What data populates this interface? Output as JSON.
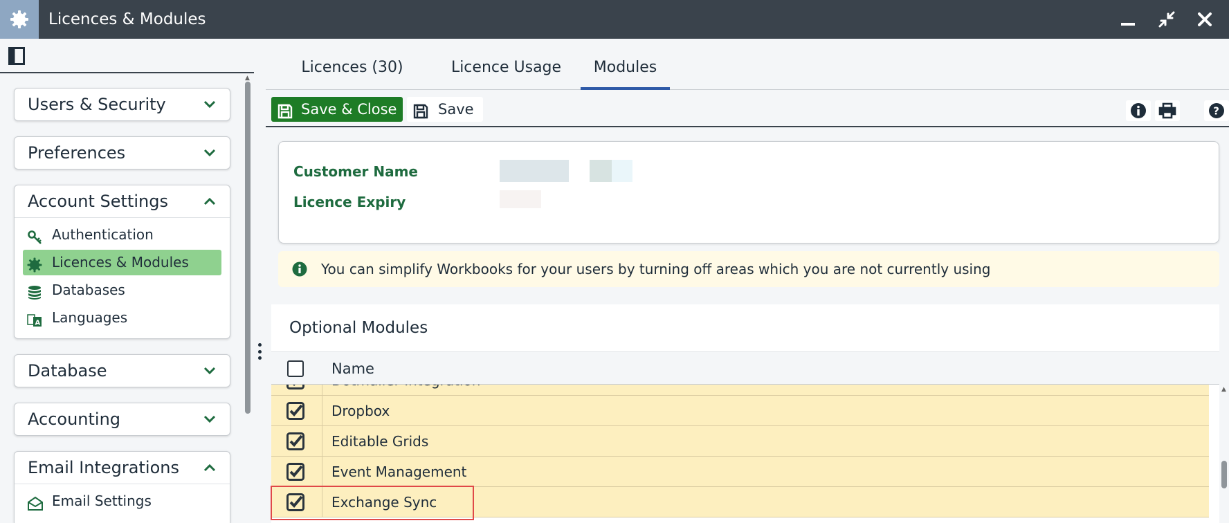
{
  "window": {
    "title": "Licences & Modules"
  },
  "sidebar": {
    "panels": [
      {
        "label": "Users & Security",
        "expanded": false
      },
      {
        "label": "Preferences",
        "expanded": false
      },
      {
        "label": "Account Settings",
        "expanded": true,
        "items": [
          {
            "label": "Authentication",
            "icon": "key-icon",
            "active": false
          },
          {
            "label": "Licences & Modules",
            "icon": "gear-badge-icon",
            "active": true
          },
          {
            "label": "Databases",
            "icon": "database-icon",
            "active": false
          },
          {
            "label": "Languages",
            "icon": "language-icon",
            "active": false
          }
        ]
      },
      {
        "label": "Database",
        "expanded": false
      },
      {
        "label": "Accounting",
        "expanded": false
      },
      {
        "label": "Email Integrations",
        "expanded": true,
        "items": [
          {
            "label": "Email Settings",
            "icon": "envelope-icon",
            "active": false
          }
        ]
      }
    ]
  },
  "tabs": [
    {
      "label": "Licences (30)",
      "active": false
    },
    {
      "label": "Licence Usage",
      "active": false
    },
    {
      "label": "Modules",
      "active": true
    }
  ],
  "toolbar": {
    "save_close_label": "Save & Close",
    "save_label": "Save"
  },
  "customer": {
    "name_label": "Customer Name",
    "expiry_label": "Licence Expiry"
  },
  "banner": {
    "text": "You can simplify Workbooks for your users by turning off areas which you are not currently using"
  },
  "modules": {
    "title": "Optional Modules",
    "column_name": "Name",
    "rows": [
      {
        "name": "Dotmailer Integration",
        "checked": true
      },
      {
        "name": "Dropbox",
        "checked": true
      },
      {
        "name": "Editable Grids",
        "checked": true
      },
      {
        "name": "Event Management",
        "checked": true
      },
      {
        "name": "Exchange Sync",
        "checked": true
      }
    ]
  },
  "colors": {
    "titlebar": "#3a434c",
    "accent_green": "#1e7c26",
    "active_item": "#8fd18f",
    "row_bg": "#fdefbf",
    "tab_underline": "#2e5aa8",
    "label_green": "#1e6b3f"
  }
}
